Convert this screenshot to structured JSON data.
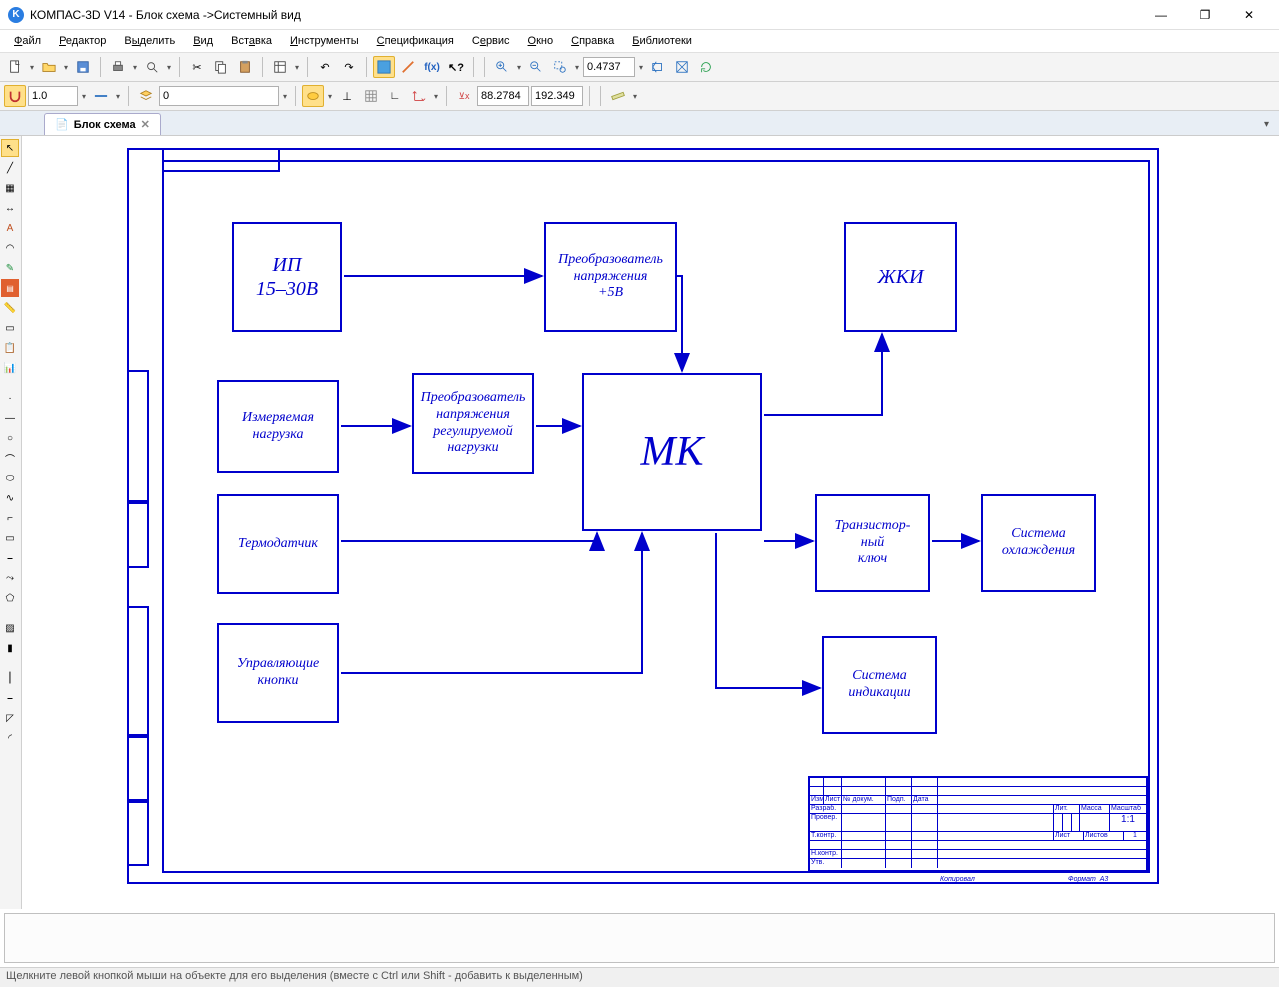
{
  "titlebar": {
    "app_icon": "K",
    "title": "КОМПАС-3D V14 - Блок схема ->Системный вид"
  },
  "menu": [
    "Файл",
    "Редактор",
    "Выделить",
    "Вид",
    "Вставка",
    "Инструменты",
    "Спецификация",
    "Сервис",
    "Окно",
    "Справка",
    "Библиотеки"
  ],
  "toolbar2": {
    "line_width": "1.0",
    "layer": "0",
    "zoom": "0.4737",
    "coord_x": "88.2784",
    "coord_y": "192.349"
  },
  "tab": {
    "label": "Блок схема"
  },
  "blocks": {
    "ip": "ИП\n15–30В",
    "conv5v": "Преобразователь\nнапряжения\n+5В",
    "lcd": "ЖКИ",
    "load": "Измеряемая\nнагрузка",
    "convreg": "Преобразователь\nнапряжения\nрегулируемой\nнагрузки",
    "mk": "МК",
    "thermo": "Термодатчик",
    "transkey": "Транзистор-\nный\nключ",
    "cooling": "Система\nохлаждения",
    "buttons": "Управляющие\nкнопки",
    "indicate": "Система\nиндикации"
  },
  "titleblock": {
    "headers": [
      "Изм",
      "Лист",
      "№ докум.",
      "Подп.",
      "Дата"
    ],
    "rows": [
      "Разраб.",
      "Провер.",
      "Т.контр.",
      "",
      "Н.контр.",
      "Утв."
    ],
    "lit": "Лит.",
    "mass": "Масса",
    "scale": "Масштаб",
    "scale_val": "1:1",
    "sheet": "Лист",
    "sheets": "Листов",
    "sheets_val": "1",
    "copier": "Копировал",
    "format": "Формат",
    "format_val": "А3"
  },
  "statusbar": "Щелкните левой кнопкой мыши на объекте для его выделения (вместе с Ctrl или Shift - добавить к выделенным)"
}
